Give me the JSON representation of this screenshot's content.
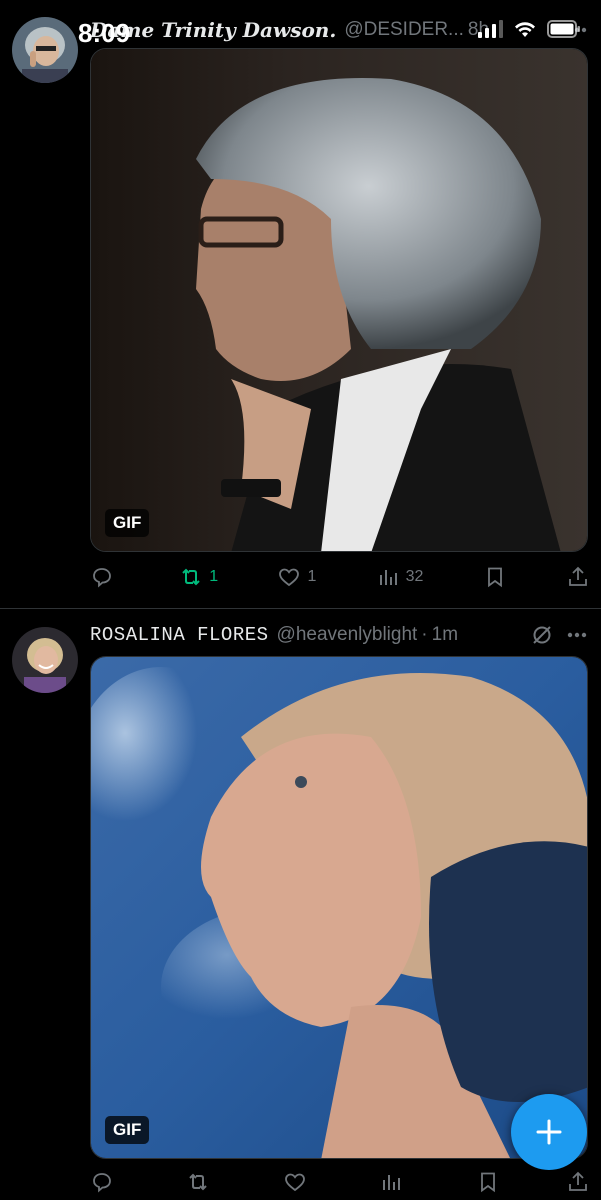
{
  "status_bar": {
    "time": "8:09"
  },
  "tweets": [
    {
      "display_name": "Dame Trinity Dawson.",
      "handle": "@DESIDER...",
      "time": "8h",
      "media_badge": "GIF",
      "actions": {
        "reply": "",
        "retweet": "1",
        "like": "1",
        "views": "32"
      }
    },
    {
      "display_name": "ROSALINA FLORES",
      "handle": "@heavenlyblight",
      "dot": "·",
      "time": "1m",
      "media_badge": "GIF",
      "actions": {
        "reply": "",
        "retweet": "",
        "like": "",
        "views": ""
      }
    }
  ],
  "fab": {
    "icon": "plus-icon"
  },
  "colors": {
    "accent": "#1d9bf0",
    "retweet_active": "#00ba7c",
    "muted": "#71767b"
  }
}
